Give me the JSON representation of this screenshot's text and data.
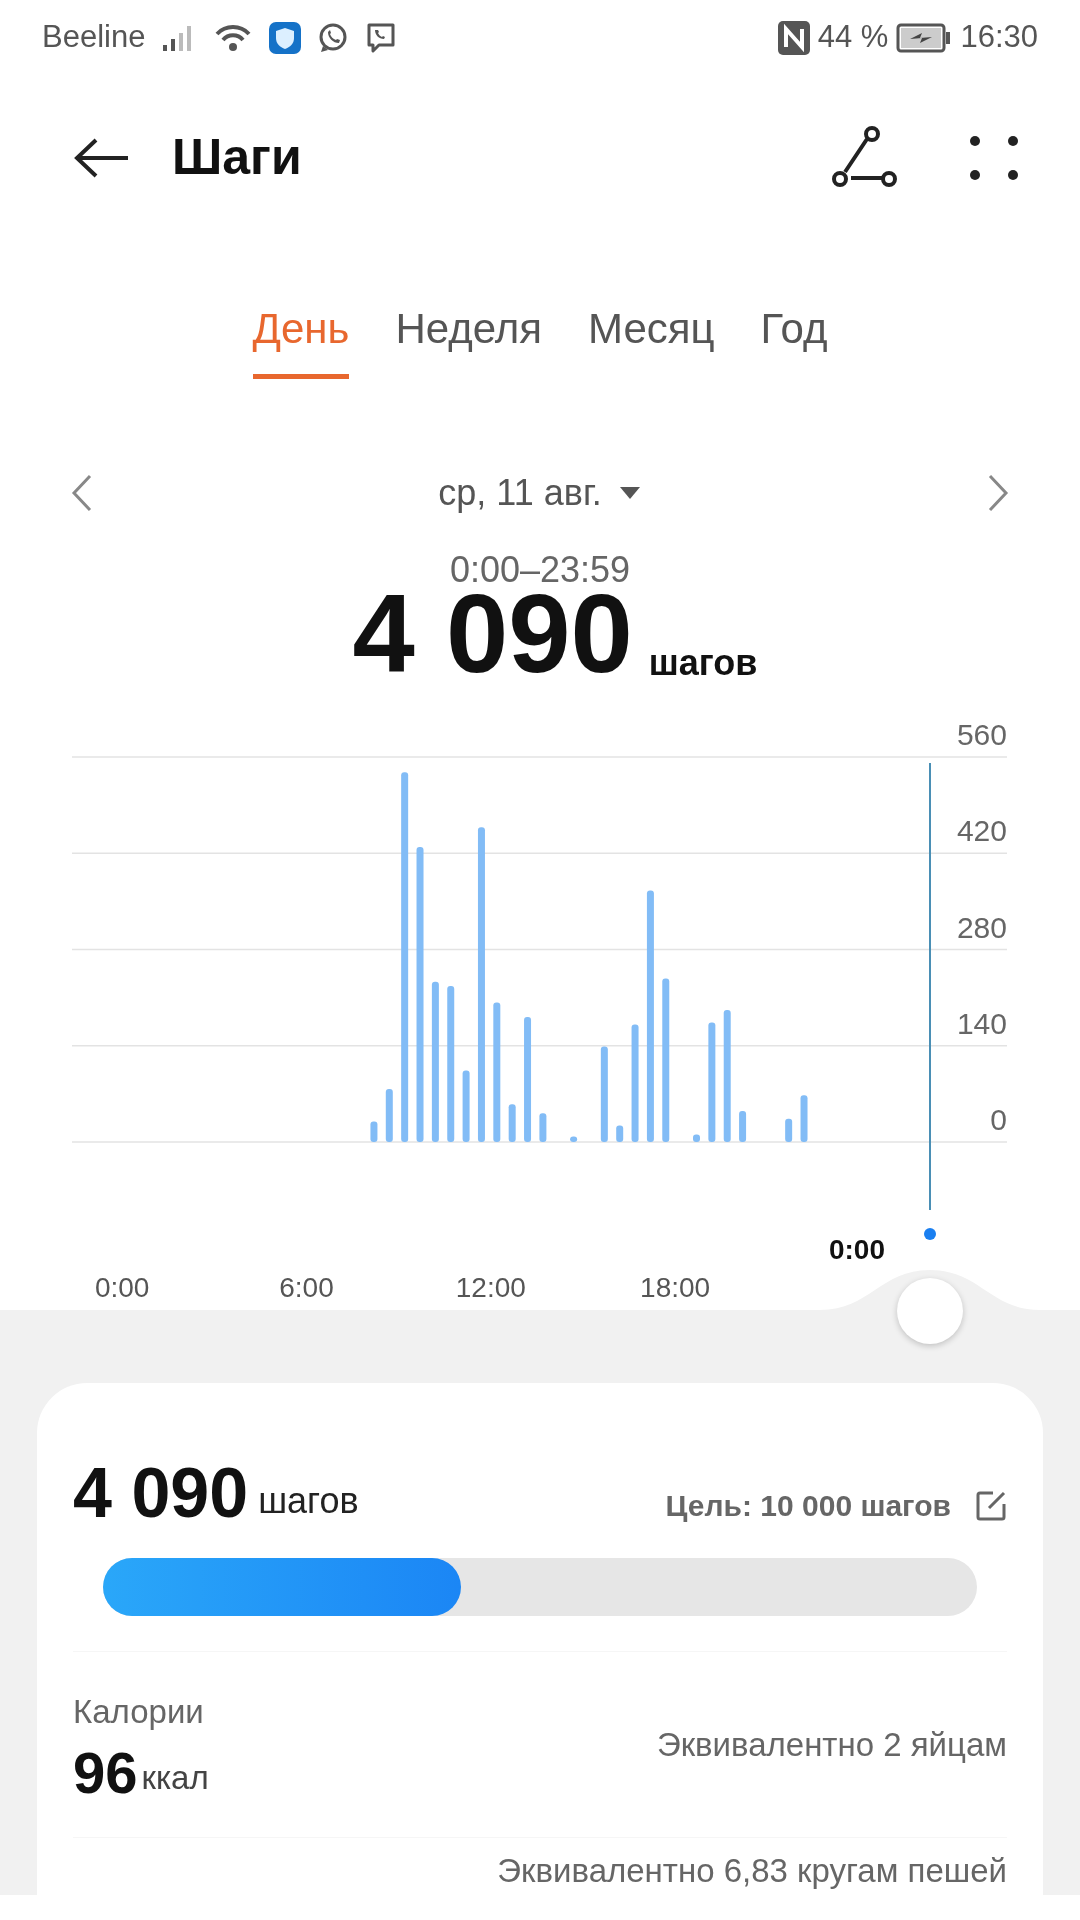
{
  "status_bar": {
    "carrier": "Beeline",
    "battery_percent": "44 %",
    "time": "16:30"
  },
  "header": {
    "title": "Шаги"
  },
  "tabs": [
    {
      "label": "День",
      "selected": true
    },
    {
      "label": "Неделя",
      "selected": false
    },
    {
      "label": "Месяц",
      "selected": false
    },
    {
      "label": "Год",
      "selected": false
    }
  ],
  "date_nav": {
    "date": "ср, 11 авг.",
    "time_range": "0:00–23:59"
  },
  "total": {
    "value": "4 090",
    "unit": "шагов"
  },
  "chart": {
    "cursor_label": "0:00",
    "chart_data": {
      "type": "bar",
      "categories": [
        "0:00",
        null,
        null,
        null,
        null,
        null,
        null,
        null,
        null,
        null,
        null,
        null,
        "6:00",
        null,
        null,
        null,
        null,
        null,
        null,
        null,
        null,
        null,
        null,
        null,
        "12:00",
        null,
        null,
        null,
        null,
        null,
        null,
        null,
        null,
        null,
        null,
        null,
        "18:00",
        null,
        null,
        null,
        null,
        null,
        null,
        null,
        null,
        null,
        null,
        null
      ],
      "series": [
        {
          "color": "#82bcf6",
          "values": [
            null,
            null,
            null,
            null,
            null,
            null,
            null,
            null,
            null,
            null,
            null,
            null,
            null,
            null,
            null,
            null,
            30,
            77,
            538,
            429,
            233,
            227,
            104,
            458,
            203,
            55,
            182,
            42,
            null,
            8,
            null,
            139,
            24,
            171,
            366,
            238,
            null,
            11,
            174,
            192,
            45,
            null,
            null,
            34,
            68,
            null,
            null,
            null
          ]
        }
      ],
      "ylim": [
        0,
        560
      ],
      "yticks": [
        0,
        140,
        280,
        420,
        560
      ],
      "grid": true
    }
  },
  "summary": {
    "steps": "4 090",
    "unit": "шагов",
    "goal": "Цель: 10 000 шагов",
    "level": 0.41
  },
  "calories": {
    "label": "Калории",
    "value": "96",
    "unit": "ккал",
    "equivalent": "Эквивалентно 2 яйцам"
  },
  "distance": {
    "equivalent": "Эквивалентно 6,83 кругам пешей"
  }
}
